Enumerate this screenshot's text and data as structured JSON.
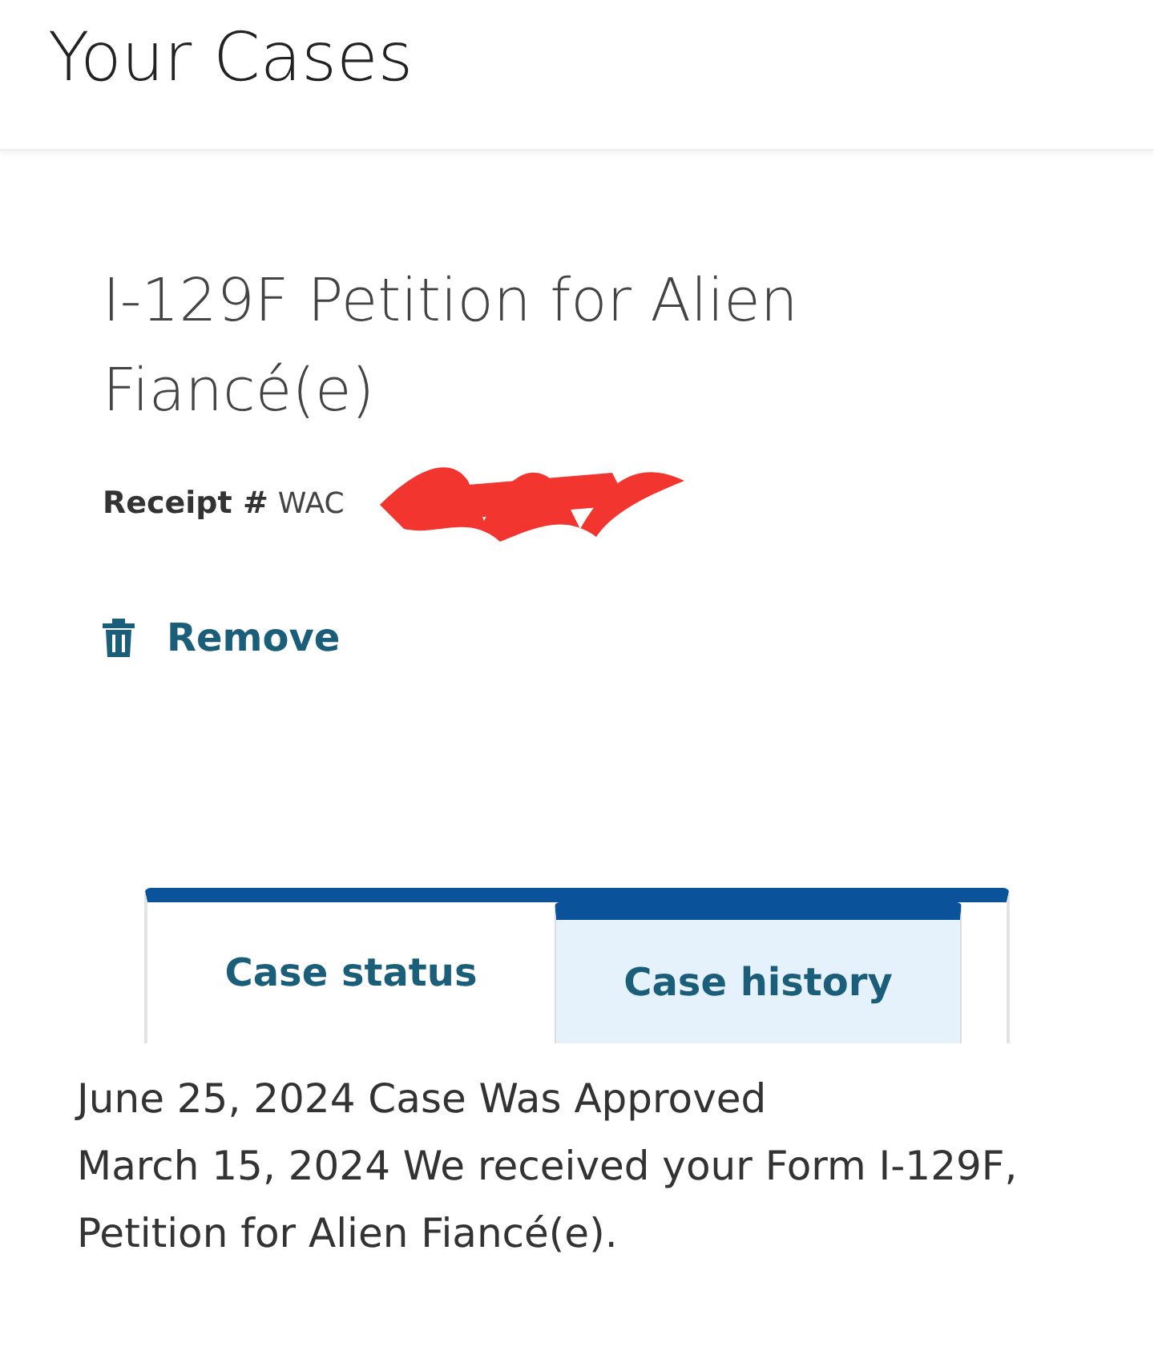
{
  "header": {
    "title": "Your Cases"
  },
  "case": {
    "title": "I-129F Petition for Alien Fiancé(e)",
    "receipt_label": "Receipt #",
    "receipt_number": "WAC",
    "remove": "Remove"
  },
  "tabs": [
    {
      "label": "Case status",
      "selected": false
    },
    {
      "label": "Case history",
      "selected": true
    }
  ],
  "history": [
    "June 25, 2024 Case Was Approved",
    "March 15, 2024 We received your Form I-129F, Petition for Alien Fiancé(e)."
  ]
}
